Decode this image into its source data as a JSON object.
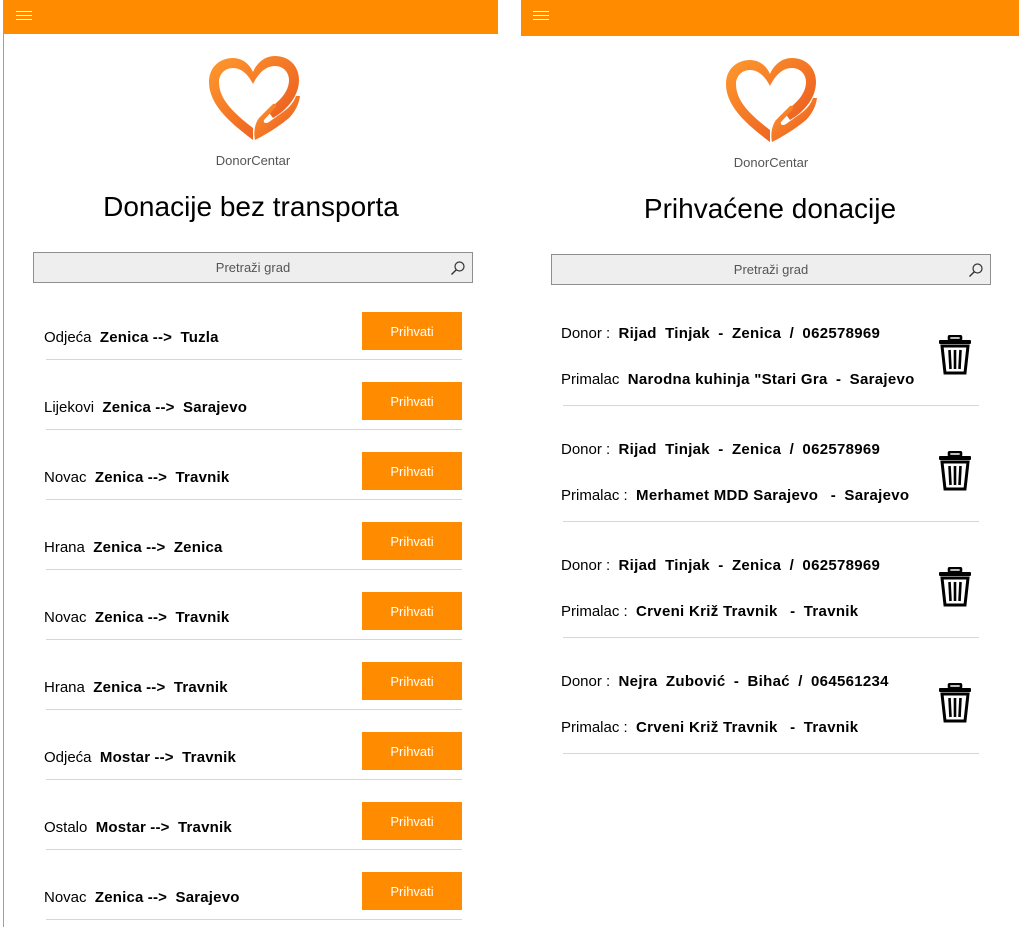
{
  "brand": {
    "name": "DonorCentar",
    "accent": "#ff8c00"
  },
  "left": {
    "title": "Donacije bez transporta",
    "search_placeholder": "Pretraži grad",
    "button_label": "Prihvati",
    "arrow": "-->",
    "items": [
      {
        "category": "Odjeća",
        "from": "Zenica",
        "to": "Tuzla"
      },
      {
        "category": "Lijekovi",
        "from": "Zenica",
        "to": "Sarajevo"
      },
      {
        "category": "Novac",
        "from": "Zenica",
        "to": "Travnik"
      },
      {
        "category": "Hrana",
        "from": "Zenica",
        "to": "Zenica"
      },
      {
        "category": "Novac",
        "from": "Zenica",
        "to": "Travnik"
      },
      {
        "category": "Hrana",
        "from": "Zenica",
        "to": "Travnik"
      },
      {
        "category": "Odjeća",
        "from": "Mostar",
        "to": "Travnik"
      },
      {
        "category": "Ostalo",
        "from": "Mostar",
        "to": "Travnik"
      },
      {
        "category": "Novac",
        "from": "Zenica",
        "to": "Sarajevo"
      }
    ]
  },
  "right": {
    "title": "Prihvaćene donacije",
    "search_placeholder": "Pretraži grad",
    "donor_label": "Donor :",
    "recv_label_full": "Primalac :",
    "cards": [
      {
        "donor_name": "Rijad",
        "donor_surname": "Tinjak",
        "donor_city": "Zenica",
        "donor_phone": "062578969",
        "recv_label": "Primalac",
        "recv_name": "Narodna kuhinja \"Stari Gra",
        "recv_city": "Sarajevo"
      },
      {
        "donor_name": "Rijad",
        "donor_surname": "Tinjak",
        "donor_city": "Zenica",
        "donor_phone": "062578969",
        "recv_label": "Primalac :",
        "recv_name": "Merhamet MDD Sarajevo",
        "recv_city": "Sarajevo"
      },
      {
        "donor_name": "Rijad",
        "donor_surname": "Tinjak",
        "donor_city": "Zenica",
        "donor_phone": "062578969",
        "recv_label": "Primalac :",
        "recv_name": "Crveni Križ Travnik",
        "recv_city": "Travnik"
      },
      {
        "donor_name": "Nejra",
        "donor_surname": "Zubović",
        "donor_city": "Bihać",
        "donor_phone": "064561234",
        "recv_label": "Primalac :",
        "recv_name": "Crveni Križ Travnik",
        "recv_city": "Travnik"
      }
    ]
  }
}
